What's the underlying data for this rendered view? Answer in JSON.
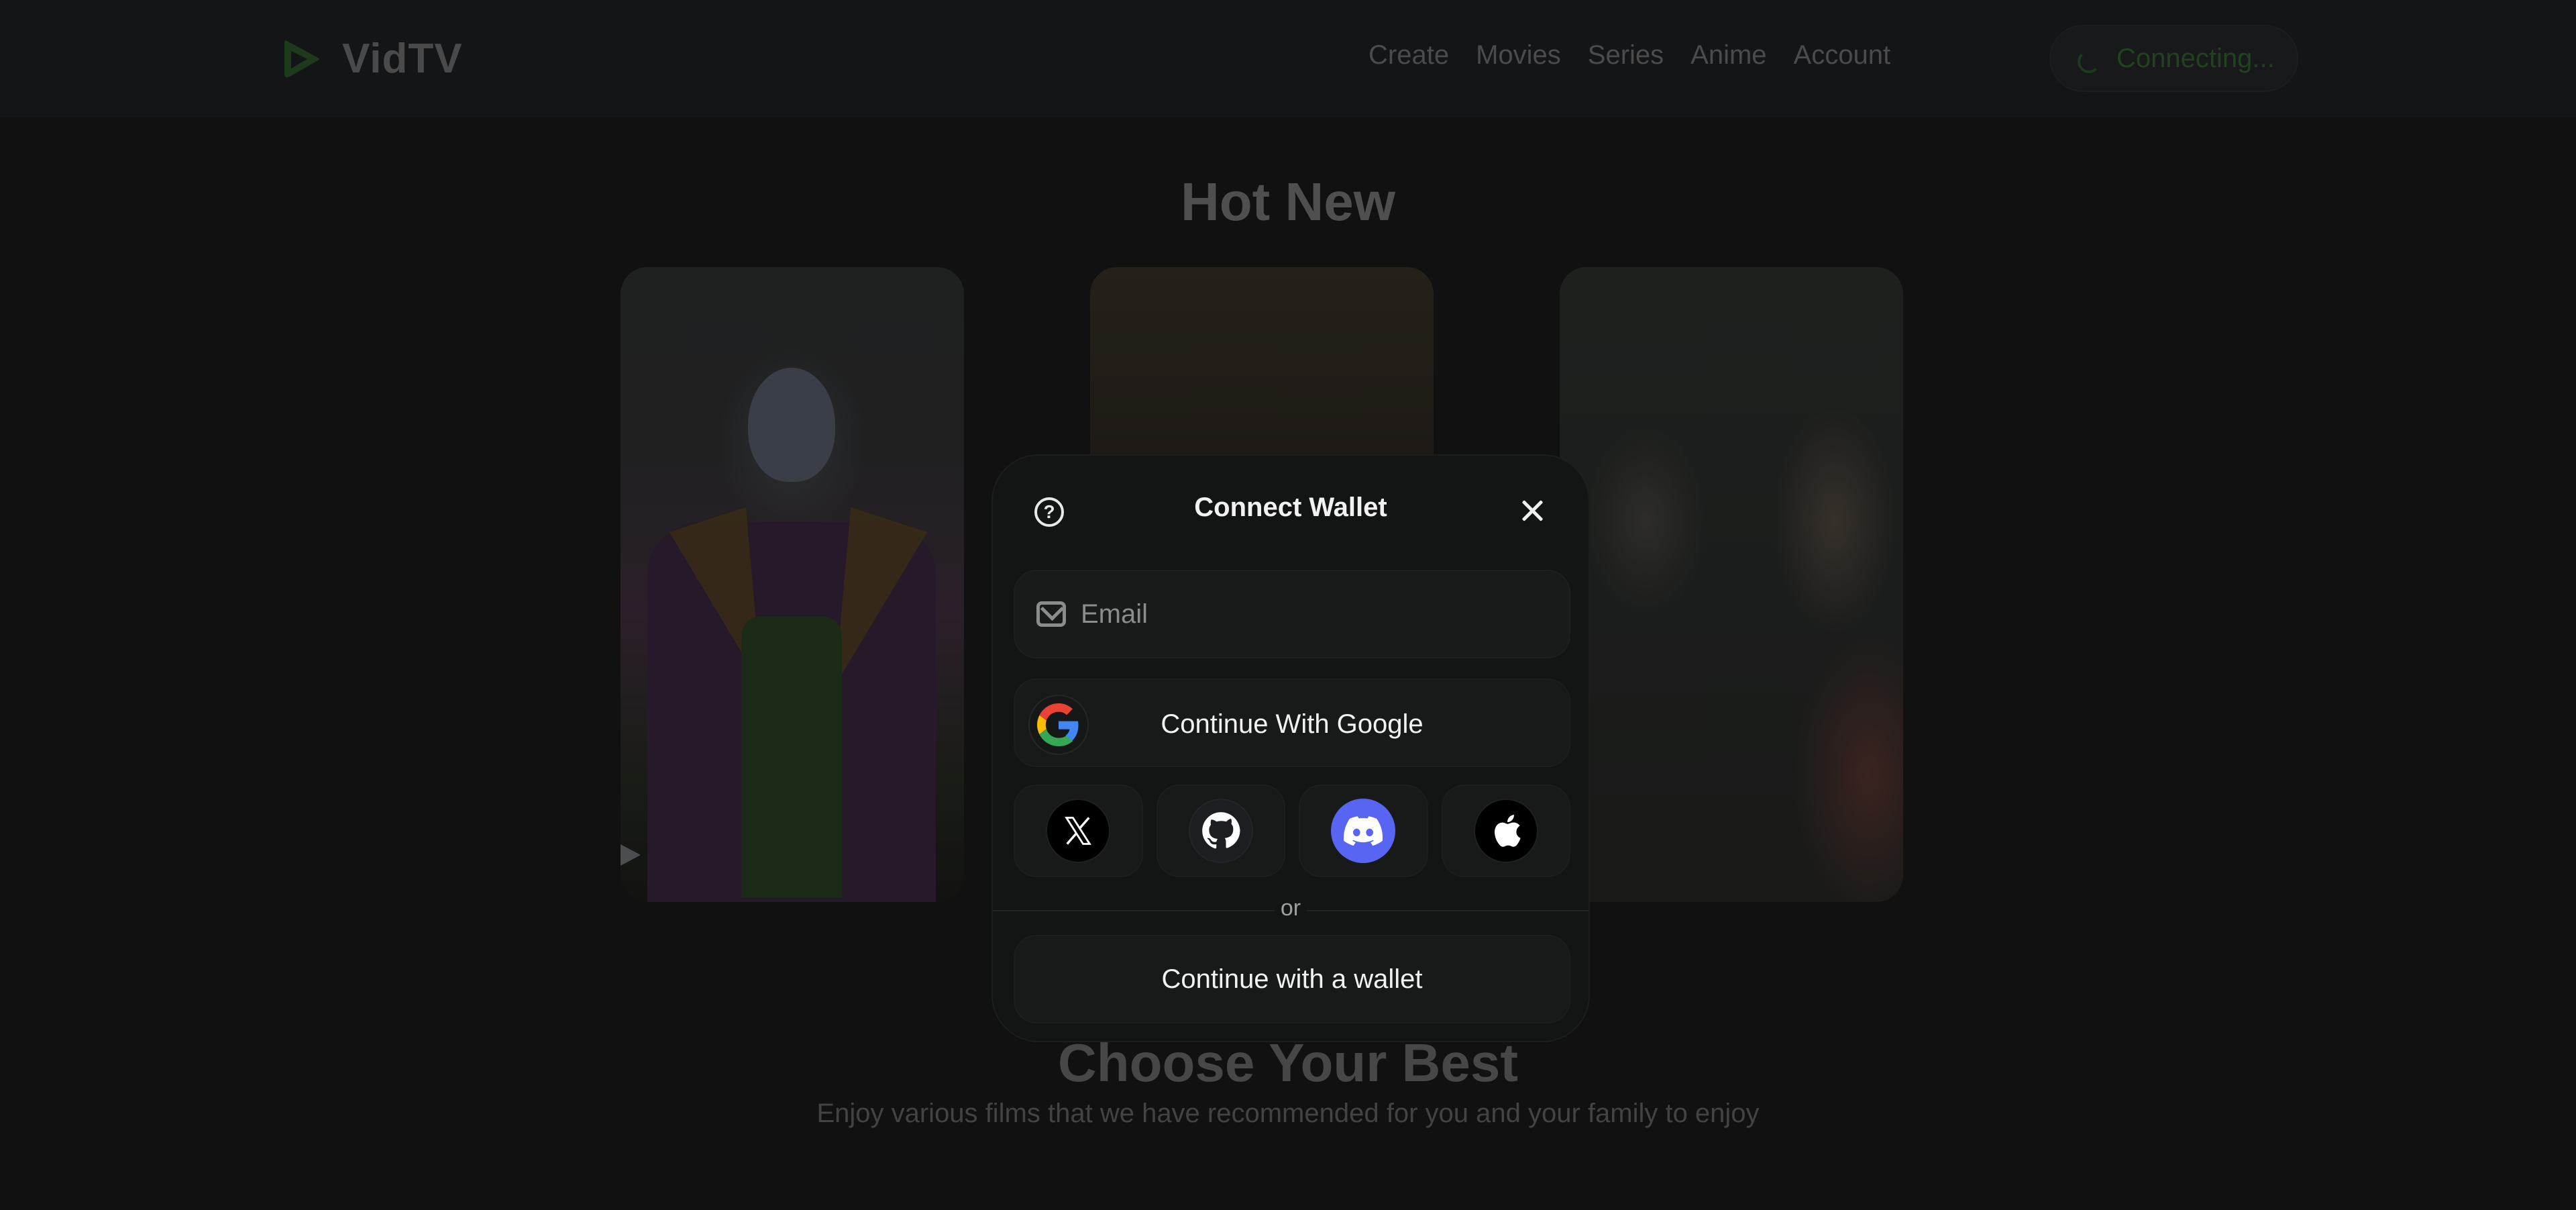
{
  "app": {
    "name": "VidTV",
    "brand_color": "#21421f"
  },
  "navbar": {
    "links": [
      {
        "label": "Create"
      },
      {
        "label": "Movies"
      },
      {
        "label": "Series"
      },
      {
        "label": "Anime"
      },
      {
        "label": "Account"
      }
    ],
    "connect_button": {
      "label": "Connecting...",
      "state": "loading"
    }
  },
  "main": {
    "hot_new_title": "Hot New",
    "posters": [
      {
        "subject": "joker-poster"
      },
      {
        "subject": "two-men-poster"
      },
      {
        "subject": "fight-club-poster"
      }
    ],
    "section_title": "Choose Your Best",
    "section_subtitle": "Enjoy various films that we have recommended for you and your family to enjoy"
  },
  "modal": {
    "title": "Connect Wallet",
    "help_icon": "question-circle-icon",
    "close_icon": "close-icon",
    "email": {
      "placeholder": "Email",
      "value": ""
    },
    "google_button": {
      "label": "Continue With Google"
    },
    "social_buttons": [
      {
        "name": "x",
        "icon": "x-logo-icon",
        "color": "#000000"
      },
      {
        "name": "github",
        "icon": "github-icon",
        "color": "#1c1e21"
      },
      {
        "name": "discord",
        "icon": "discord-icon",
        "color": "#5865f2"
      },
      {
        "name": "apple",
        "icon": "apple-icon",
        "color": "#000000"
      }
    ],
    "divider_text": "or",
    "wallet_button": {
      "label": "Continue with a wallet"
    }
  }
}
